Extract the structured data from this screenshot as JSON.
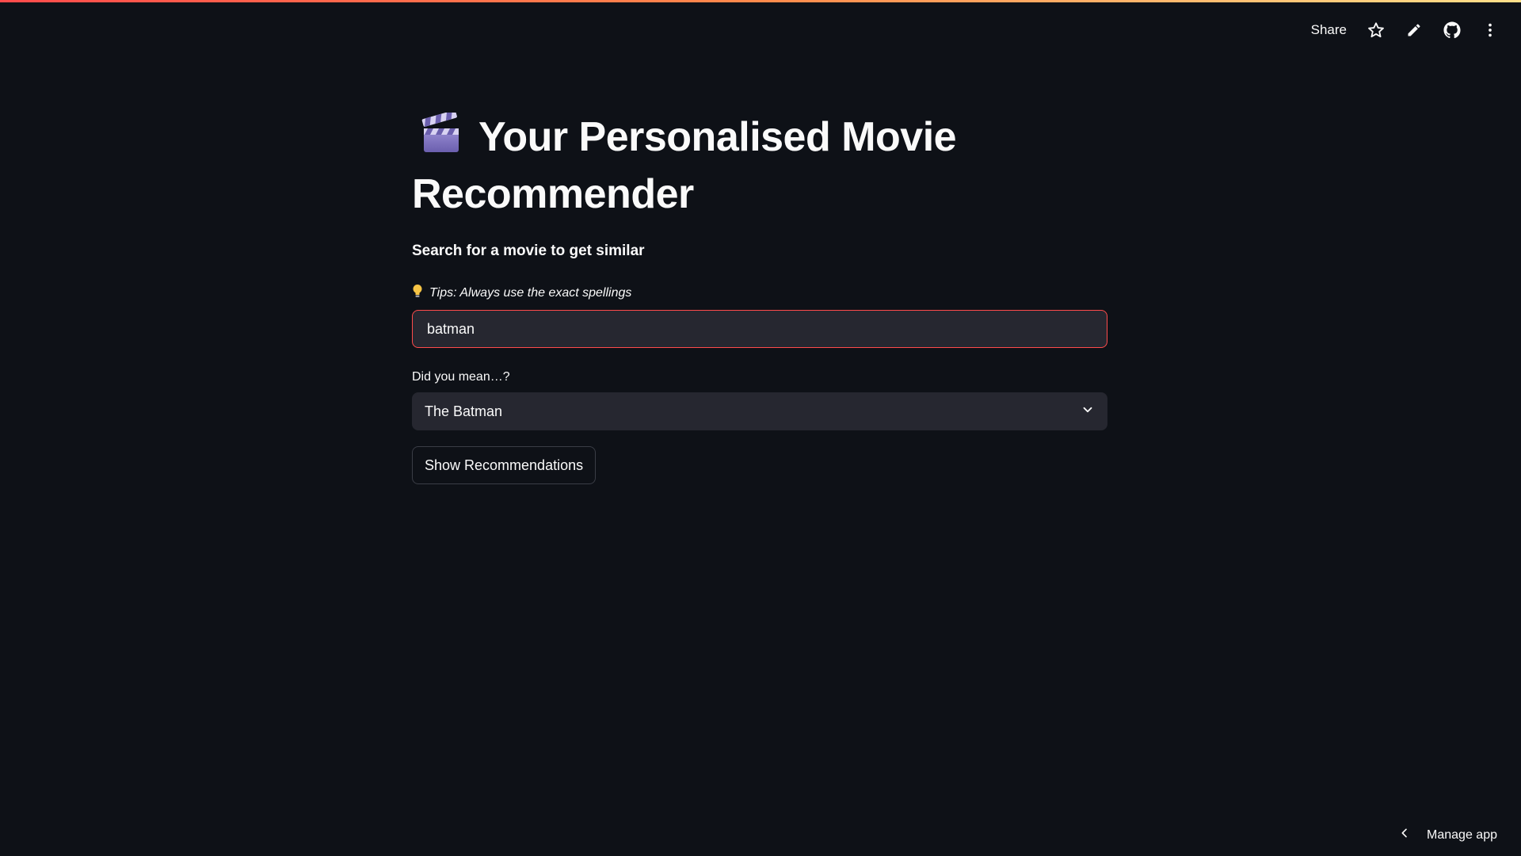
{
  "header": {
    "share_label": "Share",
    "icons": [
      "star-icon",
      "pencil-icon",
      "github-icon",
      "more-vertical-icon"
    ]
  },
  "main": {
    "title_emoji": "clapper-board-icon",
    "title": "Your Personalised Movie Recommender",
    "subheading": "Search for a movie to get similar",
    "tip": "Tips: Always use the exact spellings",
    "search_value": "batman",
    "select_label": "Did you mean…?",
    "select_value": "The Batman",
    "button_label": "Show Recommendations"
  },
  "footer": {
    "manage_app_label": "Manage app"
  },
  "colors": {
    "background": "#0e1117",
    "input_background": "#262730",
    "accent": "#ff4b4b",
    "text": "#fafafa"
  }
}
